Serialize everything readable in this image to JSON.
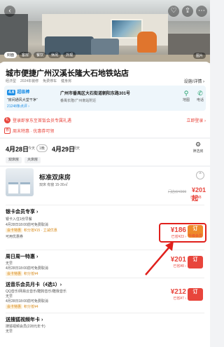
{
  "hero": {
    "photo_tabs": [
      "封面",
      "客房",
      "餐饮",
      "休闲",
      "外观"
    ],
    "photo_count": "图片"
  },
  "hotel": {
    "name": "城市便捷广州汉溪长隆大石地铁站店",
    "tags": [
      "经济型",
      "2024年装修",
      "免费停车",
      "健身房"
    ],
    "facility_link": "设施/详情 ›",
    "score": "4.6",
    "score_word": "超级棒",
    "score_quote": "\"房间通风大堂干净\"",
    "review_count": "21248条点评 ›",
    "address": "广州市番禺区大石街道朝阳东路301号",
    "address_sub": "番禺长隆/广州南站附近",
    "map_label": "地图",
    "phone_label": "电话",
    "promo_text": "登录即享东至首饭会员专属礼遇",
    "promo_link": "立即登录 ›",
    "coupon_text": "周末特惠 · 优惠券可领"
  },
  "dates": {
    "checkin": "4月28日",
    "checkin_wd": "今天",
    "nights": "1晚",
    "checkout": "4月29日",
    "checkout_wd": "明天",
    "filter_label": "筛选房"
  },
  "bed_filters": [
    "双床房",
    "大床房"
  ],
  "room": {
    "title": "标准双床房",
    "specs": "双床  有窗  15-30㎡",
    "orig_price": "门店价¥209",
    "price": "¥201起",
    "price_tag": "已省¥8"
  },
  "offers": [
    {
      "title": "银卡会员专享 ›",
      "lines": [
        "银卡入住1份早餐",
        "4月28日18:00前可免费取消"
      ],
      "badge": "会卡特惠",
      "badge_text": "积分抵¥15 · 立减优惠",
      "note": "可用优惠券",
      "price": "¥186",
      "price_sub": "已省¥23 ›",
      "btn": "订",
      "btn_sub": "升级会员"
    },
    {
      "title": "周日周一特惠 ›",
      "lines": [
        "无早",
        "4月28日18:00前可免费取消"
      ],
      "badge": "会卡特惠",
      "badge_text": "积分抵¥4",
      "price": "¥201",
      "price_sub": "已省¥8 ›",
      "btn": "订"
    },
    {
      "title": "送音乐会员月卡（4选1）›",
      "lines": [
        "QQ音乐/网易云音乐/酷狗音乐/酷我音乐",
        "无早",
        "4月28日18:00前可免费取消"
      ],
      "badge": "会卡特惠",
      "badge_text": "积分抵¥4",
      "price": "¥212",
      "price_sub": "已省¥7 ›",
      "btn": "订"
    },
    {
      "title": "送搜狐视频年卡 ›",
      "lines": [
        "搜狐视频会员(228元年卡)",
        "无早"
      ],
      "price": "",
      "btn": ""
    }
  ]
}
